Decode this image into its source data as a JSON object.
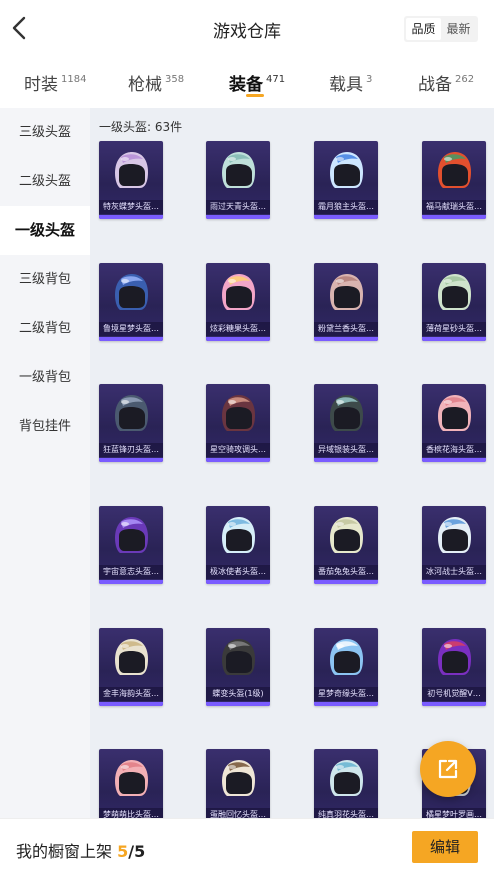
{
  "header": {
    "title": "游戏仓库",
    "sort": [
      "品质",
      "最新"
    ],
    "active_sort": 0
  },
  "tabs": [
    {
      "label": "时装",
      "count": "1184"
    },
    {
      "label": "枪械",
      "count": "358"
    },
    {
      "label": "装备",
      "count": "471",
      "active": true
    },
    {
      "label": "载具",
      "count": "3"
    },
    {
      "label": "战备",
      "count": "262"
    }
  ],
  "sidebar": [
    "三级头盔",
    "二级头盔",
    "一级头盔",
    "三级背包",
    "二级背包",
    "一级背包",
    "背包挂件"
  ],
  "sidebar_active": 2,
  "content": {
    "count_label": "一级头盔: 63件"
  },
  "items": [
    {
      "name": "特灰蝶梦头盔…",
      "color": "#d8c7e6",
      "accent": "#b48ad6"
    },
    {
      "name": "雨过天青头盔…",
      "color": "#bfe0da",
      "accent": "#7fb8b0"
    },
    {
      "name": "霜月狼主头盔…",
      "color": "#cde6ff",
      "accent": "#3a7be0"
    },
    {
      "name": "福马献瑞头盔…",
      "color": "#e2502e",
      "accent": "#3aa06a"
    },
    {
      "name": "鲁境星梦头盔…",
      "color": "#3a5fb0",
      "accent": "#9fb8ff"
    },
    {
      "name": "炫彩糖果头盔…",
      "color": "#f3a6c8",
      "accent": "#ffd36b"
    },
    {
      "name": "粉黛兰香头盔…",
      "color": "#d9b4b0",
      "accent": "#b07c76"
    },
    {
      "name": "薄荷星砂头盔…",
      "color": "#cfe3cc",
      "accent": "#9cc19a"
    },
    {
      "name": "狂蓝锋刃头盔…",
      "color": "#4b5a70",
      "accent": "#9aa9c2"
    },
    {
      "name": "星空骑攻调头…",
      "color": "#6a3540",
      "accent": "#e0a08c"
    },
    {
      "name": "异域银装头盔…",
      "color": "#3d4a4a",
      "accent": "#9cd0d0"
    },
    {
      "name": "香槟花海头盔…",
      "color": "#f1b3ba",
      "accent": "#e07a86"
    },
    {
      "name": "宇宙意志头盔…",
      "color": "#6a3ab8",
      "accent": "#b39bff"
    },
    {
      "name": "极冰使者头盔…",
      "color": "#d6eef8",
      "accent": "#68aedb"
    },
    {
      "name": "番茄兔兔头盔…",
      "color": "#e6e8cc",
      "accent": "#bfc29a"
    },
    {
      "name": "冰河战士头盔…",
      "color": "#e4eef6",
      "accent": "#4c90d8"
    },
    {
      "name": "金丰海韵头盔…",
      "color": "#e9e2cf",
      "accent": "#c8b27a"
    },
    {
      "name": "蝶变头盔(1级)",
      "color": "#3a3a3a",
      "accent": "#888888"
    },
    {
      "name": "星梦奇缘头盔…",
      "color": "#8cc4f2",
      "accent": "#ffffff"
    },
    {
      "name": "初号机觉醒V…",
      "color": "#7a2fc0",
      "accent": "#e0405a"
    },
    {
      "name": "梦萌萌比头盔…",
      "color": "#f3b0b5",
      "accent": "#e07a82"
    },
    {
      "name": "蛋融回忆头盔…",
      "color": "#efe6d6",
      "accent": "#6b4a2a"
    },
    {
      "name": "纯真羽花头盔…",
      "color": "#cfe6ec",
      "accent": "#5fb0cf"
    },
    {
      "name": "橘星梦叶罗画…",
      "color": "#cfd2d8",
      "accent": "#8a8e98"
    }
  ],
  "footer": {
    "label": "我的橱窗上架",
    "current": "5",
    "separator": "/",
    "total": "5",
    "edit": "编辑"
  }
}
